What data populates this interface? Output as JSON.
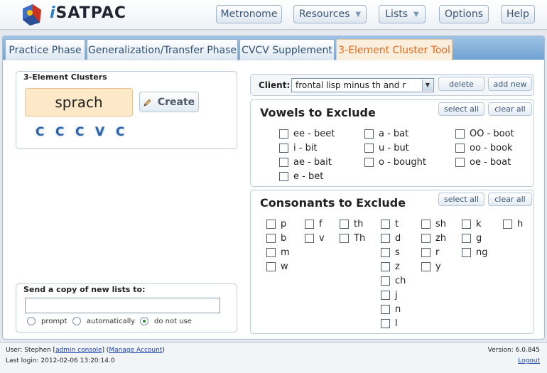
{
  "header": {
    "logo_prefix": "i",
    "logo_text": "SATPAC",
    "nav": [
      {
        "label": "Metronome"
      },
      {
        "label": "Resources",
        "caret": "▼"
      },
      {
        "label": "Lists",
        "caret": "▼"
      },
      {
        "label": "Options"
      },
      {
        "label": "Help"
      }
    ]
  },
  "tabs": [
    {
      "label": "Practice Phase"
    },
    {
      "label": "Generalization/Transfer Phase"
    },
    {
      "label": "CVCV Supplement"
    },
    {
      "label": "3-Element Cluster Tool",
      "active": true
    }
  ],
  "cluster_panel": {
    "title": "3-Element Clusters",
    "word": "sprach",
    "create_label": "Create",
    "pattern": [
      "C",
      "C",
      "C",
      "V",
      "C"
    ]
  },
  "send_copy": {
    "title": "Send a copy of new lists to:",
    "email_value": "",
    "options": [
      {
        "label": "prompt",
        "selected": false
      },
      {
        "label": "automatically",
        "selected": false
      },
      {
        "label": "do not use",
        "selected": true
      }
    ]
  },
  "client": {
    "label": "Client:",
    "selected": "frontal lisp minus th and r",
    "delete_label": "delete",
    "add_label": "add new"
  },
  "vowels": {
    "title": "Vowels to Exclude",
    "select_all": "select all",
    "clear_all": "clear all",
    "items": [
      "ee - beet",
      "i - bit",
      "ae - bait",
      "e - bet",
      "a - bat",
      "u - but",
      "o - bought",
      "OO - boot",
      "oo - book",
      "oe - boat"
    ]
  },
  "consonants": {
    "title": "Consonants to Exclude",
    "select_all": "select all",
    "clear_all": "clear all",
    "items": [
      "p",
      "b",
      "m",
      "w",
      "f",
      "v",
      "th",
      "Th",
      "t",
      "d",
      "s",
      "z",
      "ch",
      "j",
      "n",
      "l",
      "sh",
      "zh",
      "r",
      "y",
      "k",
      "g",
      "ng",
      "h"
    ]
  },
  "footer": {
    "user_text": "User: Stephen [",
    "admin_link": "admin console",
    "mid_text": "] (",
    "manage_link": "Manage Account",
    "end_text": ")",
    "last_login": "Last login: 2012-02-06 13:20:14.0",
    "version": "Version: 6.0.845",
    "logout": "Logout"
  },
  "colors": {
    "accent": "#e06a1f",
    "link": "#1b3fae",
    "pattern": "#2b62a8"
  }
}
